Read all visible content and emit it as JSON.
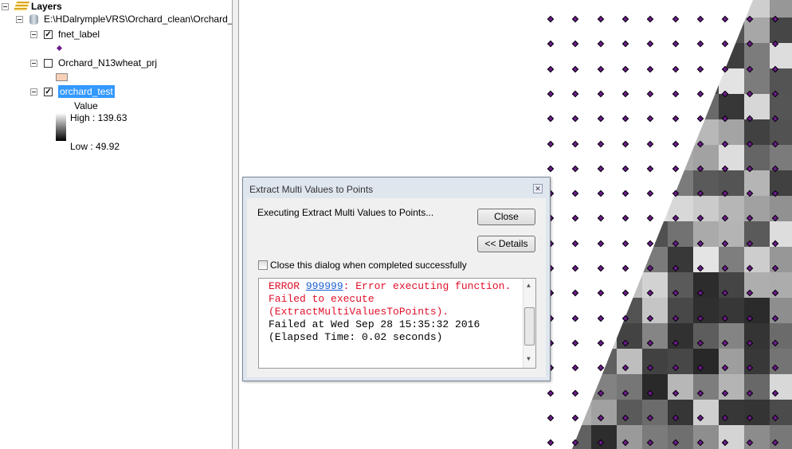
{
  "toc": {
    "root_label": "Layers",
    "source_path": "E:\\HDalrympleVRS\\Orchard_clean\\Orchard_C",
    "layers": [
      {
        "name": "fnet_label",
        "checked": true
      },
      {
        "name": "Orchard_N13wheat_prj",
        "checked": false
      },
      {
        "name": "orchard_test",
        "checked": true,
        "selected": true
      }
    ],
    "legend": {
      "field": "Value",
      "high": "High : 139.63",
      "low": "Low : 49.92"
    }
  },
  "dialog": {
    "title": "Extract Multi Values to Points",
    "status": "Executing Extract Multi Values to Points...",
    "close_label": "Close",
    "details_label": "<< Details",
    "checkbox_label": "Close this dialog when completed successfully",
    "checkbox_checked": false,
    "log": {
      "error_prefix": "ERROR ",
      "error_code": "999999",
      "error_msg": ": Error executing function.",
      "line2": "Failed to execute",
      "line3": "(ExtractMultiValuesToPoints).",
      "line4": "Failed at Wed Sep 28 15:35:32 2016",
      "line5": "(Elapsed Time: 0.02 seconds)"
    }
  },
  "colors": {
    "point": "#6a1b8a",
    "selection": "#3399ff",
    "error": "#e0102a"
  }
}
